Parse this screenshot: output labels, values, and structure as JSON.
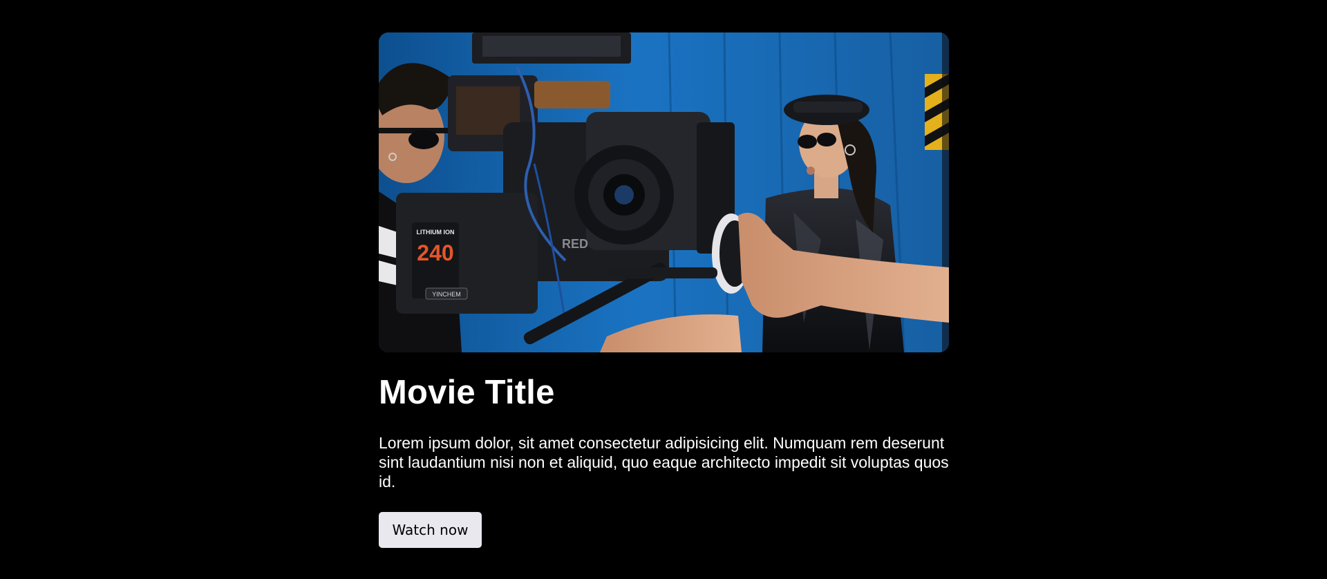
{
  "movie": {
    "title": "Movie Title",
    "description": "Lorem ipsum dolor, sit amet consectetur adipisicing elit. Numquam rem deserunt sint laudantium nisi non et aliquid, quo eaque architecto impedit sit voluptas quos id.",
    "watch_label": "Watch now",
    "image_alt": "Film crew operating a RED cinema camera while filming a woman in a black leather jacket and cap against a blue wall"
  },
  "camera_marks": {
    "battery_brand": "LITHIUM ION",
    "battery_capacity": "240",
    "battery_maker": "YINCHEM",
    "camera_brand": "RED"
  },
  "colors": {
    "background": "#000000",
    "text": "#ffffff",
    "button_bg": "#e9e8ee",
    "wall_blue": "#1a6bb5"
  }
}
